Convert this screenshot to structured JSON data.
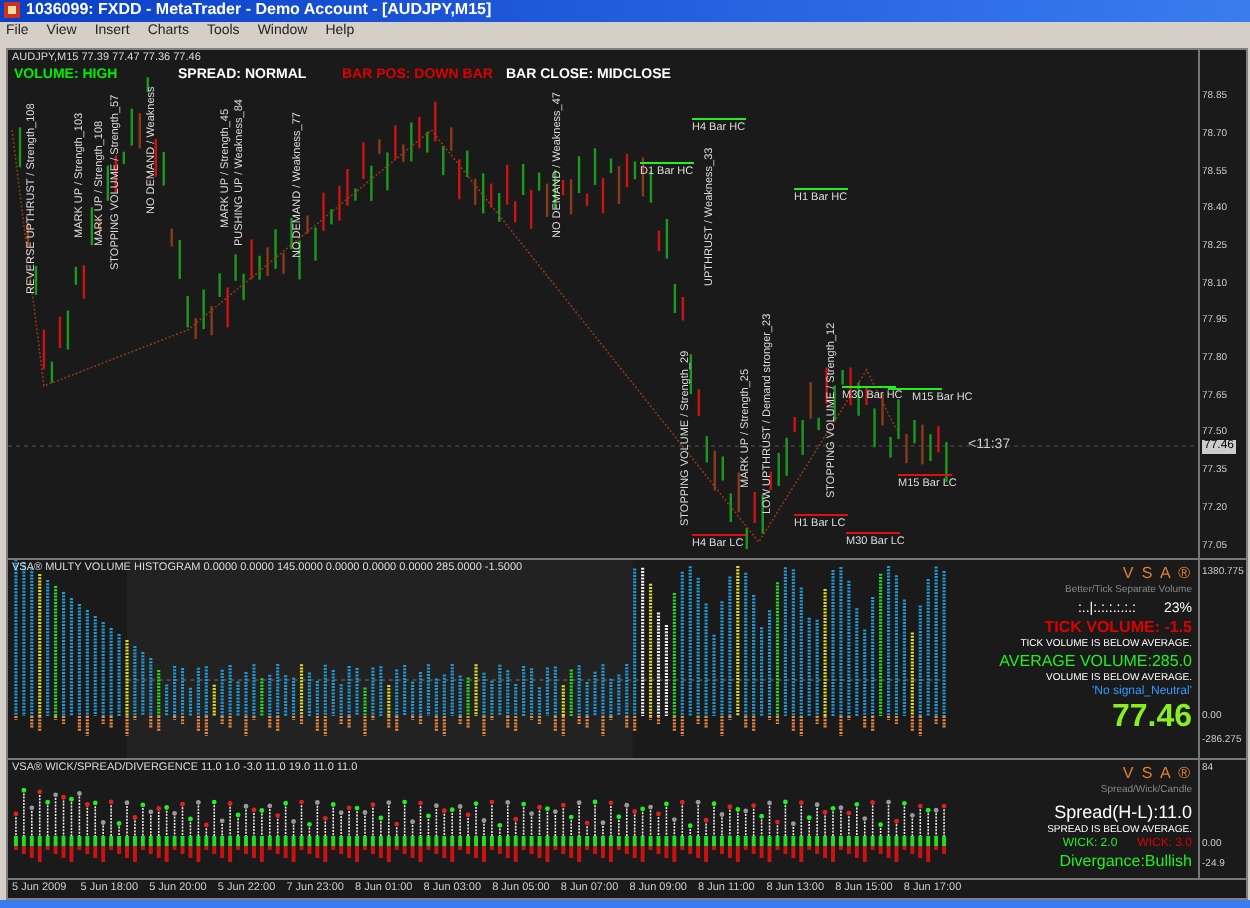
{
  "window": {
    "title": "1036099: FXDD - MetaTrader - Demo Account - [AUDJPY,M15]"
  },
  "menu": [
    "File",
    "View",
    "Insert",
    "Charts",
    "Tools",
    "Window",
    "Help"
  ],
  "chart": {
    "header": "AUDJPY,M15  77.39 77.47 77.36 77.46",
    "status": [
      {
        "text": "VOLUME: HIGH",
        "color": "#00ee00"
      },
      {
        "text": "SPREAD: NORMAL",
        "color": "#ffffff"
      },
      {
        "text": "BAR POS: DOWN BAR",
        "color": "#dd0000"
      },
      {
        "text": "BAR CLOSE: MIDCLOSE",
        "color": "#ffffff"
      }
    ],
    "annotations": [
      "REVERSE UPTHRUST / Strength_108",
      "MARK UP / Strength_103",
      "MARK UP / Strength_108",
      "STOPPING VOLUME / Strength_57",
      "NO DEMAND / Weakness",
      "MARK UP / Strength_45",
      "PUSHING UP / Weakness_84",
      "NO DEMAND / Weakness_77",
      "NO DEMAND / Weakness_47",
      "UPTHRUST / Weakness_33",
      "STOPPING VOLUME / Strength_29",
      "MARK UP / Strength_25",
      "LOW UPTHRUST / Demand stronger_23",
      "STOPPING VOLUME / Strength_12"
    ],
    "levels": [
      {
        "label": "H4 Bar HC",
        "kind": "high"
      },
      {
        "label": "D1 Bar HC",
        "kind": "high"
      },
      {
        "label": "H1 Bar HC",
        "kind": "high"
      },
      {
        "label": "M30 Bar HC",
        "kind": "high"
      },
      {
        "label": "M15 Bar HC",
        "kind": "high"
      },
      {
        "label": "H4 Bar LC",
        "kind": "low"
      },
      {
        "label": "H1 Bar LC",
        "kind": "low"
      },
      {
        "label": "M30 Bar LC",
        "kind": "low"
      },
      {
        "label": "M15 Bar LC",
        "kind": "low"
      }
    ],
    "countdown": "<11:37",
    "price_axis": [
      "78.85",
      "78.70",
      "78.55",
      "78.40",
      "78.25",
      "78.10",
      "77.95",
      "77.80",
      "77.65",
      "77.50",
      "77.35",
      "77.20",
      "77.05"
    ],
    "current_price": "77.46"
  },
  "histogram": {
    "header": "VSA® MULTY VOLUME HISTOGRAM 0.0000 0.0000 145.0000 0.0000 0.0000 0.0000 285.0000 -1.5000",
    "brand": "V S A ®",
    "subtitle": "Better/Tick Separate Volume",
    "meter": ":..|:.:.:.:.:.:",
    "percent": "23%",
    "tick_volume": "TICK VOLUME: -1.5",
    "tick_note": "TICK VOLUME IS BELOW AVERAGE.",
    "average_volume": "AVERAGE VOLUME:285.0",
    "volume_note": "VOLUME IS BELOW AVERAGE.",
    "signal": "'No signal_Neutral'",
    "price": "77.46",
    "axis": [
      "1380.775",
      "0.00",
      "-286.275"
    ]
  },
  "wick": {
    "header": "VSA® WICK/SPREAD/DIVERGENCE 11.0 1.0 -3.0 11.0 19.0 11.0 11.0",
    "brand": "V S A ®",
    "subtitle": "Spread/Wick/Candle",
    "spread": "Spread(H-L):11.0",
    "spread_note": "SPREAD IS BELOW AVERAGE.",
    "wick_up": "WICK: 2.0",
    "wick_down": "WICK: 3.0",
    "divergence": "Divergance:Bullish",
    "axis": [
      "84",
      "0.00",
      "-24.9"
    ]
  },
  "time_axis": [
    "5 Jun 2009",
    "5 Jun 18:00",
    "5 Jun 20:00",
    "5 Jun 22:00",
    "7 Jun 23:00",
    "8 Jun 01:00",
    "8 Jun 03:00",
    "8 Jun 05:00",
    "8 Jun 07:00",
    "8 Jun 09:00",
    "8 Jun 11:00",
    "8 Jun 13:00",
    "8 Jun 15:00",
    "8 Jun 17:00"
  ]
}
